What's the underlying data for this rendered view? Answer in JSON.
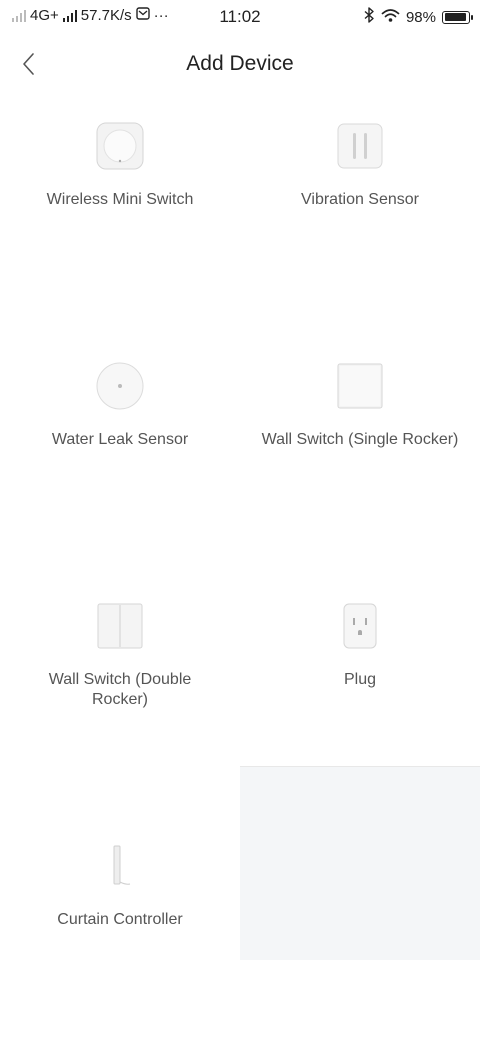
{
  "status_bar": {
    "network": "4G+",
    "speed": "57.7K/s",
    "more": "···",
    "time": "11:02",
    "battery_text": "98%",
    "battery_level": 0.98
  },
  "header": {
    "title": "Add Device"
  },
  "devices": [
    {
      "label": "Wireless Mini Switch",
      "icon": "wireless-mini-switch-icon"
    },
    {
      "label": "Vibration Sensor",
      "icon": "vibration-sensor-icon"
    },
    {
      "label": "Water Leak Sensor",
      "icon": "water-leak-sensor-icon"
    },
    {
      "label": "Wall Switch (Single Rocker)",
      "icon": "wall-switch-single-icon"
    },
    {
      "label": "Wall Switch (Double Rocker)",
      "icon": "wall-switch-double-icon"
    },
    {
      "label": "Plug",
      "icon": "plug-icon"
    },
    {
      "label": "Curtain Controller",
      "icon": "curtain-controller-icon"
    }
  ],
  "colors": {
    "background": "#ffffff",
    "empty_cell": "#f4f6f8",
    "label": "#555555",
    "title": "#222222"
  }
}
